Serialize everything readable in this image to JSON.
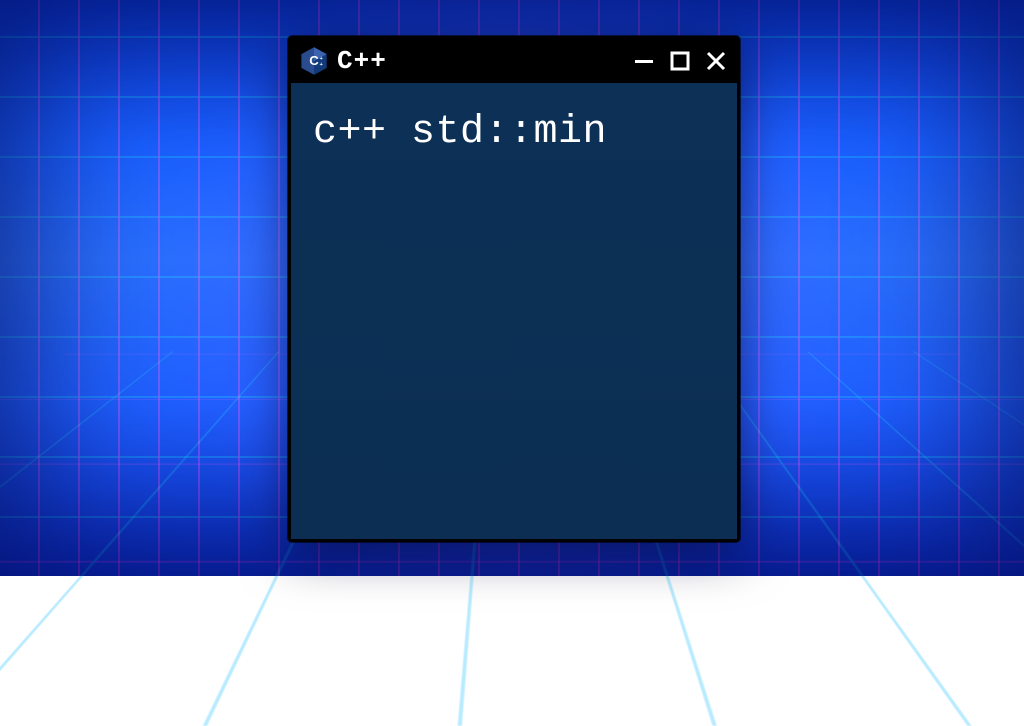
{
  "window": {
    "title": "C++",
    "icon": "cpp-logo-icon",
    "controls": {
      "minimize": "minimize-icon",
      "maximize": "maximize-icon",
      "close": "close-icon"
    }
  },
  "content": {
    "line1": "c++ std::min"
  },
  "colors": {
    "window_bg": "#0b2f52",
    "titlebar_bg": "#000000",
    "text": "#ffffff",
    "backdrop_primary": "#1a5fff",
    "accent_magenta": "#ff00c8",
    "accent_cyan": "#00dcff"
  }
}
